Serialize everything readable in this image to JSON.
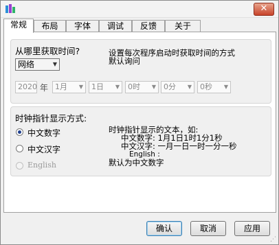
{
  "tabs": [
    "常规",
    "布局",
    "字体",
    "调试",
    "反馈",
    "关于"
  ],
  "active_tab": 0,
  "time_source": {
    "title": "从哪里获取时间?",
    "selected": "网络",
    "description_line1": "设置每次程序启动时获取时间的方式",
    "description_line2": "默认询问"
  },
  "datetime": {
    "year": "2020",
    "year_label": "年",
    "month": "1月",
    "day": "1日",
    "hour": "0时",
    "minute": "0分",
    "second": "0秒"
  },
  "pointer_mode": {
    "title": "时钟指针显示方式:",
    "options": [
      "中文数字",
      "中文汉字",
      "English"
    ],
    "selected": 0,
    "description": [
      "时钟指针显示的文本，如:",
      "中文数字: 1月1日1时1分1秒",
      "中文汉字: 一月一日一时一分一秒",
      "English :",
      "默认为中文数字"
    ]
  },
  "buttons": {
    "ok": "确认",
    "cancel": "取消",
    "apply": "应用"
  },
  "title_bar": {
    "close_glyph": "✕"
  }
}
